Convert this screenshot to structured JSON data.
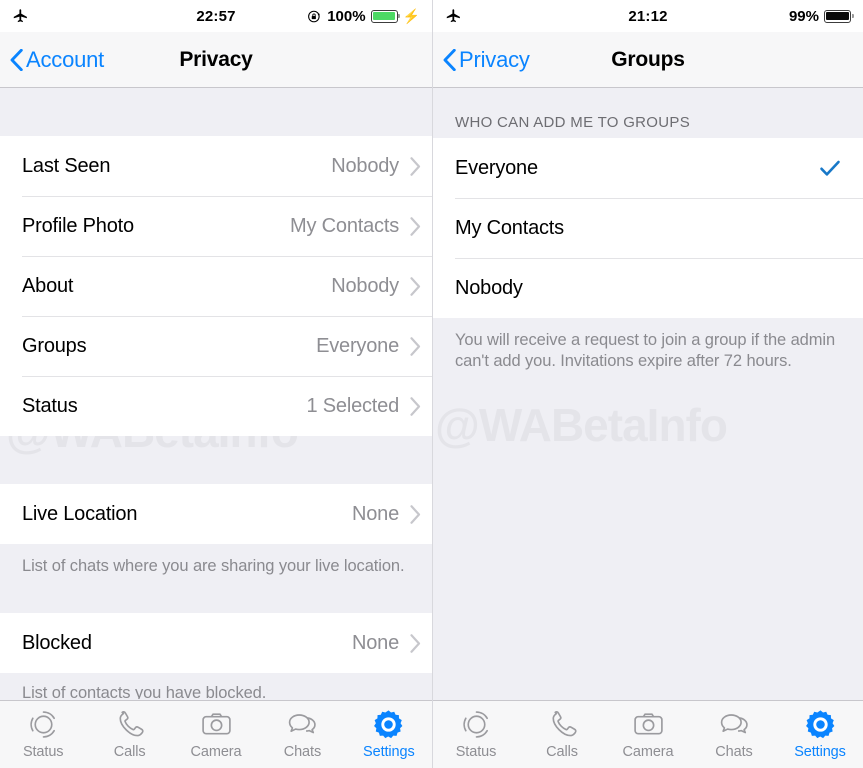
{
  "watermark": "@WABetaInfo",
  "colors": {
    "accent_blue": "#0a84ff",
    "check_blue": "#1878c8",
    "gray_value": "#8e8e93",
    "bg_gray": "#efeff4",
    "nav_bg": "#f7f7f8",
    "battery_green": "#4cd964"
  },
  "left_screen": {
    "statusbar": {
      "airplane_icon": "airplane-icon",
      "time": "22:57",
      "rotation_lock_icon": "rotation-lock-icon",
      "battery_percent": "100%",
      "battery_style": "green",
      "charging_icon": "lightning-bolt-icon"
    },
    "navbar": {
      "back_label": "Account",
      "back_icon": "chevron-left-icon",
      "title": "Privacy"
    },
    "groups": [
      {
        "rows": [
          {
            "label": "Last Seen",
            "value": "Nobody",
            "accessory": "chevron-right-icon"
          },
          {
            "label": "Profile Photo",
            "value": "My Contacts",
            "accessory": "chevron-right-icon"
          },
          {
            "label": "About",
            "value": "Nobody",
            "accessory": "chevron-right-icon"
          },
          {
            "label": "Groups",
            "value": "Everyone",
            "accessory": "chevron-right-icon"
          },
          {
            "label": "Status",
            "value": "1 Selected",
            "accessory": "chevron-right-icon"
          }
        ],
        "footnote": ""
      },
      {
        "rows": [
          {
            "label": "Live Location",
            "value": "None",
            "accessory": "chevron-right-icon"
          }
        ],
        "footnote": "List of chats where you are sharing your live location."
      },
      {
        "rows": [
          {
            "label": "Blocked",
            "value": "None",
            "accessory": "chevron-right-icon"
          }
        ],
        "footnote": "List of contacts you have blocked."
      }
    ],
    "tabbar": {
      "tabs": [
        {
          "label": "Status",
          "icon": "status-rings-icon",
          "active": false
        },
        {
          "label": "Calls",
          "icon": "phone-icon",
          "active": false
        },
        {
          "label": "Camera",
          "icon": "camera-icon",
          "active": false
        },
        {
          "label": "Chats",
          "icon": "chat-bubbles-icon",
          "active": false
        },
        {
          "label": "Settings",
          "icon": "gear-icon",
          "active": true
        }
      ]
    }
  },
  "right_screen": {
    "statusbar": {
      "airplane_icon": "airplane-icon",
      "time": "21:12",
      "battery_percent": "99%",
      "battery_style": "black"
    },
    "navbar": {
      "back_label": "Privacy",
      "back_icon": "chevron-left-icon",
      "title": "Groups"
    },
    "section_header": "WHO CAN ADD ME TO GROUPS",
    "options": [
      {
        "label": "Everyone",
        "selected": true
      },
      {
        "label": "My Contacts",
        "selected": false
      },
      {
        "label": "Nobody",
        "selected": false
      }
    ],
    "footnote": "You will receive a request to join a group if the admin can't add you. Invitations expire after 72 hours.",
    "tabbar": {
      "tabs": [
        {
          "label": "Status",
          "icon": "status-rings-icon",
          "active": false
        },
        {
          "label": "Calls",
          "icon": "phone-icon",
          "active": false
        },
        {
          "label": "Camera",
          "icon": "camera-icon",
          "active": false
        },
        {
          "label": "Chats",
          "icon": "chat-bubbles-icon",
          "active": false
        },
        {
          "label": "Settings",
          "icon": "gear-icon",
          "active": true
        }
      ]
    }
  }
}
